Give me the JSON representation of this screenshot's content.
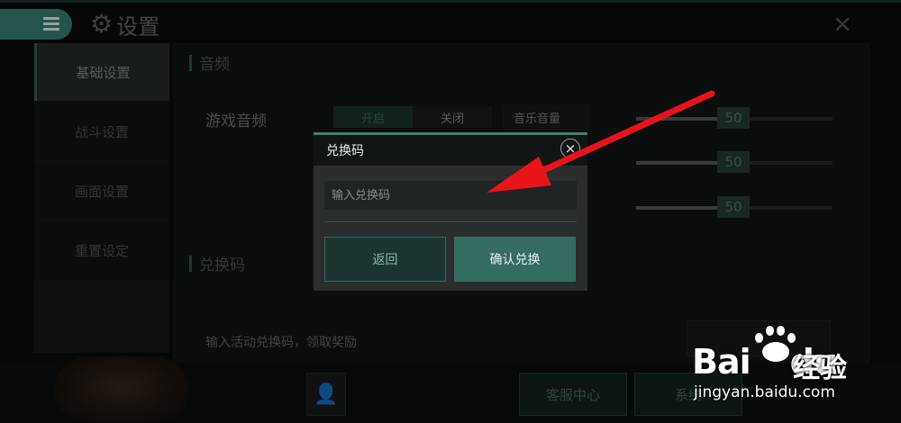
{
  "header": {
    "title": "设置",
    "menu_icon": "menu-icon",
    "settings_icon": "gear-icon",
    "close_icon": "close-icon"
  },
  "sidebar": {
    "items": [
      {
        "label": "基础设置",
        "active": true
      },
      {
        "label": "战斗设置",
        "active": false
      },
      {
        "label": "画面设置",
        "active": false
      },
      {
        "label": "重置设定",
        "active": false
      }
    ]
  },
  "audio": {
    "section_title": "音频",
    "game_audio_label": "游戏音频",
    "toggle_on": "开启",
    "toggle_off": "关闭",
    "music_volume_label": "音乐音量",
    "sliders": [
      {
        "value": "50",
        "level": 0.5
      },
      {
        "value": "50",
        "level": 0.5
      },
      {
        "value": "50",
        "level": 0.5
      }
    ]
  },
  "redeem": {
    "section_title": "兑换码",
    "description": "输入活动兑换码，领取奖励"
  },
  "footer": {
    "customer_service": "客服中心",
    "system": "系统"
  },
  "dialog": {
    "title": "兑换码",
    "input_placeholder": "输入兑换码",
    "back_button": "返回",
    "confirm_button": "确认兑换"
  },
  "watermark": {
    "brand": "Bai",
    "brand_du": "du",
    "jingyan": "经验",
    "url": "jingyan.baidu.com"
  },
  "colors": {
    "accent": "#3b8a7c",
    "confirm": "#356c62",
    "arrow": "#e8141a"
  }
}
